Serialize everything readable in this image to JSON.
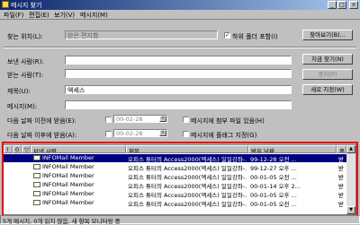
{
  "window": {
    "title": "메시지 찾기",
    "buttons": {
      "minimize": "_",
      "maximize": "□",
      "close": "×"
    }
  },
  "menubar": {
    "items": [
      "파일(F)",
      "편집(E)",
      "보기(V)",
      "메시지(M)"
    ]
  },
  "search": {
    "location_label": "찾는 위치(L):",
    "location_value": "받은 편지함",
    "include_subfolders_label": "하위 폴더 포함(I)",
    "include_subfolders_checked": true,
    "browse_button": "찾아보기(B)...",
    "from_label": "보낸 사람(R):",
    "from_value": "",
    "to_label": "받는 사람(T):",
    "to_value": "",
    "subject_label": "제목(U):",
    "subject_value": "액세스",
    "message_label": "메시지(M):",
    "message_value": "",
    "find_now_button": "지금 찾기(N)",
    "stop_button": "중지(P)",
    "new_search_button": "새로 지정(W)",
    "received_before_label": "다음 날짜 이전에 받음(E):",
    "received_before_value": "00-02-28",
    "received_after_label": "다음 날짜 이후에 받음(A):",
    "received_after_value": "00-02-28",
    "has_attachment_label": "메시지에 첨부 파일 있음(H)",
    "flagged_label": "메시지에 플래그 지정(G)"
  },
  "results": {
    "columns": [
      "!",
      "0",
      "▽",
      "보낸 사람",
      "제목",
      "받은 날짜",
      "폴"
    ],
    "rows": [
      {
        "from": "INFOMail Member",
        "subject": "오피스 튜터의 Access2000(엑세스) 일일강좌-...",
        "date": "99-12-28 오전 ...",
        "folder": "받",
        "selected": true
      },
      {
        "from": "INFOMail Member",
        "subject": "오피스 튜터의 Access2000(엑세스) 일일강좌-...",
        "date": "99-12-27 오후 ...",
        "folder": "받",
        "selected": false
      },
      {
        "from": "INFOMail Member",
        "subject": "오피스 튜터의 Access2000(엑세스) 일일강좌-...",
        "date": "00-01-05 오전 ...",
        "folder": "받",
        "selected": false
      },
      {
        "from": "INFOMail Member",
        "subject": "오피스 튜터의 Access2000(엑세스) 일일강좌-...",
        "date": "00-01-14 오후 2...",
        "folder": "받",
        "selected": false
      },
      {
        "from": "INFOMail Member",
        "subject": "오피스 튜터의 Access2000(엑세스) 일일강좌-...",
        "date": "00-01-05 오후 ...",
        "folder": "받",
        "selected": false
      },
      {
        "from": "INFOMail Member",
        "subject": "오피스 튜터의 Access2000(엑세스) 일일강좌-...",
        "date": "00-01-05 오전 ...",
        "folder": "받",
        "selected": false
      }
    ]
  },
  "status": {
    "text": "5개 메시지, 0개 읽지 않음, 새 항목 모니터링 중"
  },
  "colors": {
    "title_gradient_start": "#0a246a",
    "selection": "#000080",
    "highlight_box": "#e60000"
  }
}
